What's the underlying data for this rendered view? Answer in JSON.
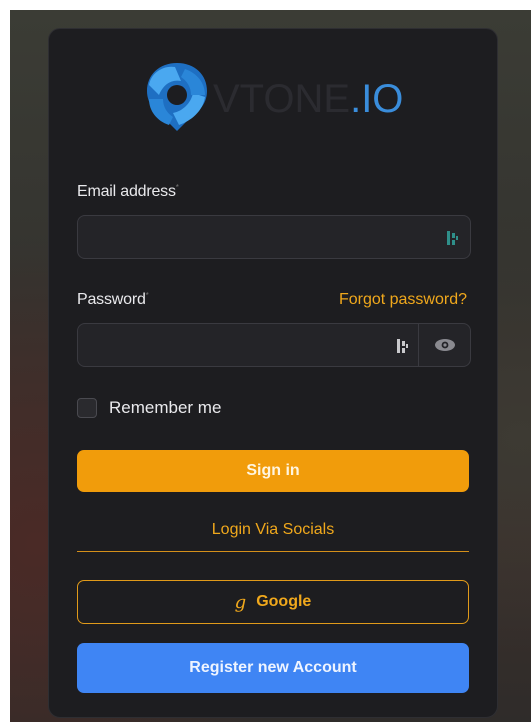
{
  "brand": {
    "logo_text_dark": "VTONE",
    "logo_text_blue": ".IO",
    "logo_color": "#3a8ddb"
  },
  "form": {
    "email": {
      "label": "Email address",
      "required_mark": "*",
      "value": "",
      "placeholder": ""
    },
    "password": {
      "label": "Password",
      "required_mark": "*",
      "value": "",
      "placeholder": "",
      "toggle_icon": "eye-icon"
    },
    "forgot_password": "Forgot password?",
    "remember_me": {
      "label": "Remember me",
      "checked": false
    },
    "sign_in": "Sign in"
  },
  "socials": {
    "heading": "Login Via Socials",
    "google_label": "Google",
    "google_icon": "google-g-icon"
  },
  "register": {
    "label": "Register new Account"
  },
  "colors": {
    "accent_orange": "#f19c0b",
    "register_blue": "#3f85f4",
    "card_bg": "#1d1d20"
  }
}
